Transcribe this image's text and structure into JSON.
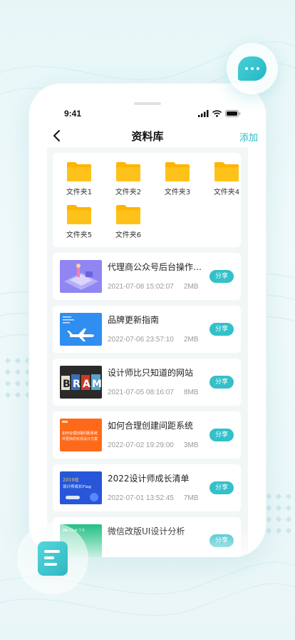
{
  "status_bar": {
    "time": "9:41"
  },
  "nav": {
    "title": "资料库",
    "action": "添加"
  },
  "folders": [
    {
      "label": "文件夹1"
    },
    {
      "label": "文件夹2"
    },
    {
      "label": "文件夹3"
    },
    {
      "label": "文件夹4"
    },
    {
      "label": "文件夹5"
    },
    {
      "label": "文件夹6"
    }
  ],
  "files": [
    {
      "title": "代理商公众号后台操作流…",
      "date": "2021-07-08 15:02:07",
      "size": "2MB",
      "share": "分享",
      "thumb": "isometric-illustration"
    },
    {
      "title": "品牌更新指南",
      "date": "2022-07-06 23:57:10",
      "size": "2MB",
      "share": "分享",
      "thumb": "airplane-blue"
    },
    {
      "title": "设计师比只知道的网站",
      "date": "2021-07-05 08:16:07",
      "size": "8MB",
      "share": "分享",
      "thumb": "BRAM-letters"
    },
    {
      "title": "如何合理创建间距系统",
      "date": "2022-07-02 19:29:00",
      "size": "3MB",
      "share": "分享",
      "thumb": "orange-poster"
    },
    {
      "title": "2022设计师成长清单",
      "date": "2022-07-01 13:52:45",
      "size": "7MB",
      "share": "分享",
      "thumb": "blue-poster"
    },
    {
      "title": "微信改版UI设计分析",
      "date": "",
      "size": "",
      "share": "分享",
      "thumb": "green-poster"
    }
  ],
  "thumb_text": {
    "orange_line1": "如何合理创建间距系统",
    "orange_line2": "并更快的实现设计方案",
    "blue_line1": "2019年",
    "blue_line2": "设计师成长Flag",
    "green_line1": "We Chat 7.0"
  },
  "colors": {
    "accent": "#34c0c9",
    "folder": "#ffb400",
    "background": "#e6f6f7"
  }
}
